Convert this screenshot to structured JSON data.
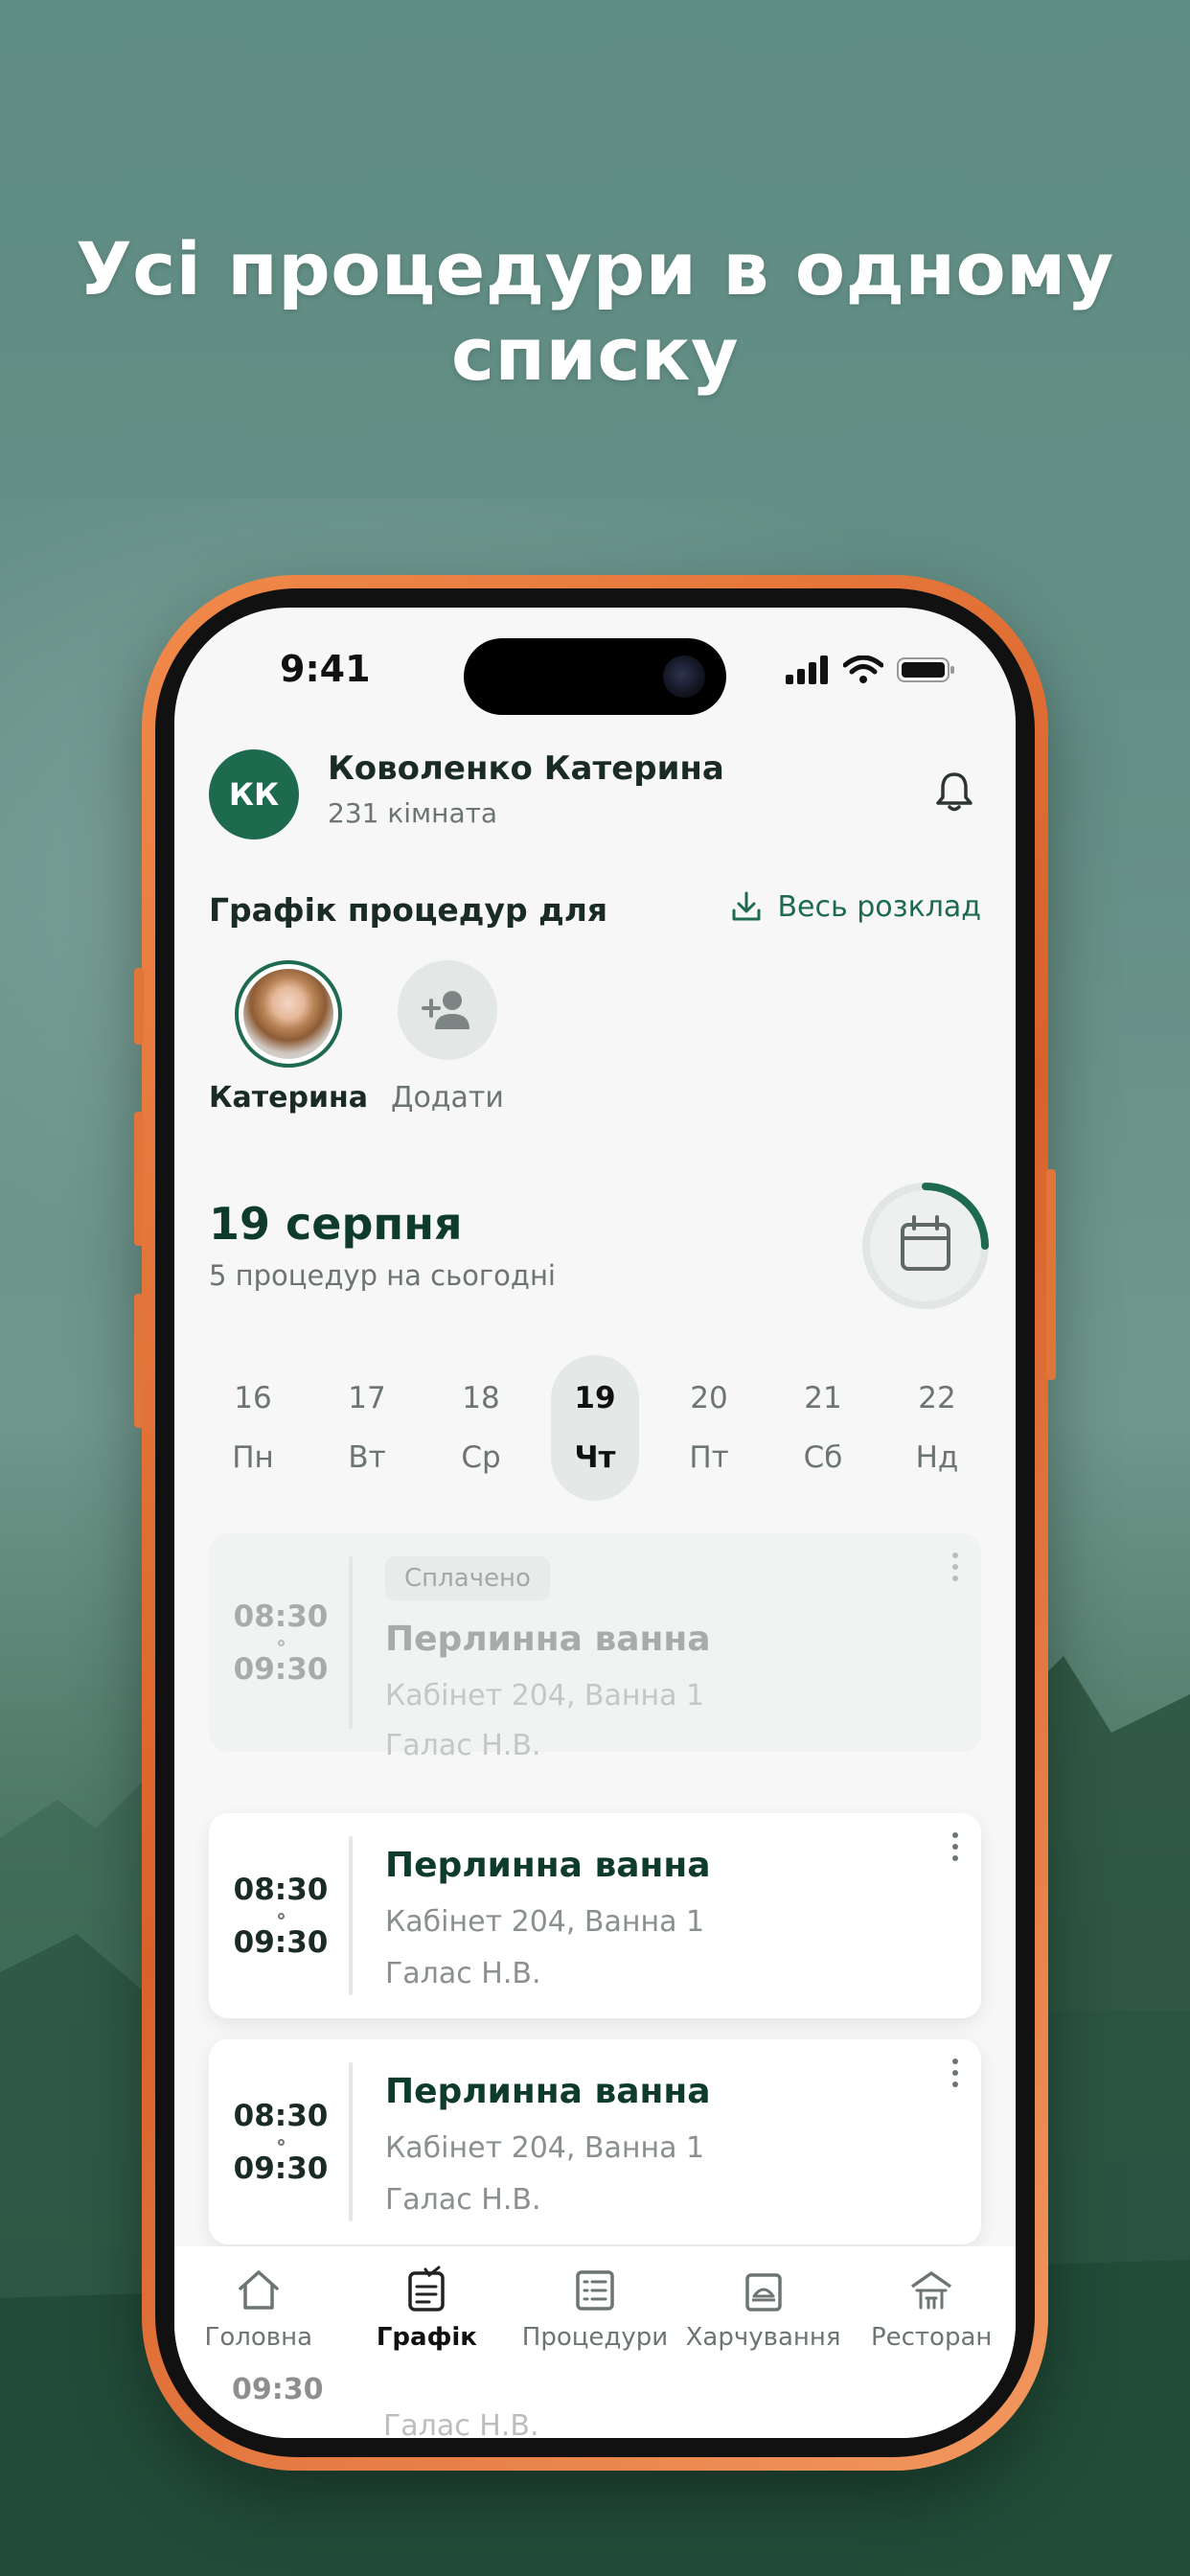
{
  "headline": "Усі процедури в одному списку",
  "status": {
    "time": "9:41"
  },
  "user": {
    "initials": "КК",
    "name": "Коволенко Катерина",
    "room": "231 кімната"
  },
  "schedule": {
    "title": "Графік процедур для",
    "full_schedule_link": "Весь розклад",
    "people": [
      {
        "name": "Катерина",
        "selected": true
      }
    ],
    "add_label": "Додати"
  },
  "date": {
    "title": "19 серпня",
    "subtitle": "5 процедур на сьогодні",
    "progress_fraction": 0.25
  },
  "days": [
    {
      "num": "16",
      "wd": "Пн"
    },
    {
      "num": "17",
      "wd": "Вт"
    },
    {
      "num": "18",
      "wd": "Ср"
    },
    {
      "num": "19",
      "wd": "Чт",
      "active": true
    },
    {
      "num": "20",
      "wd": "Пт"
    },
    {
      "num": "21",
      "wd": "Сб"
    },
    {
      "num": "22",
      "wd": "Нд"
    }
  ],
  "procedures": [
    {
      "badge": "Сплачено",
      "start": "08:30",
      "end": "09:30",
      "title": "Перлинна ванна",
      "room": "Кабінет 204, Ванна 1",
      "doctor": "Галас Н.В."
    },
    {
      "start": "08:30",
      "end": "09:30",
      "title": "Перлинна ванна",
      "room": "Кабінет 204, Ванна 1",
      "doctor": "Галас Н.В."
    },
    {
      "start": "08:30",
      "end": "09:30",
      "title": "Перлинна ванна",
      "room": "Кабінет 204, Ванна 1",
      "doctor": "Галас Н.В."
    }
  ],
  "peek": {
    "time": "09:30",
    "doctor": "Галас Н.В."
  },
  "tabs": [
    {
      "label": "Головна",
      "icon": "home-icon"
    },
    {
      "label": "Графік",
      "icon": "schedule-icon",
      "active": true
    },
    {
      "label": "Процедури",
      "icon": "list-icon"
    },
    {
      "label": "Харчування",
      "icon": "meal-icon"
    },
    {
      "label": "Ресторан",
      "icon": "restaurant-icon"
    }
  ],
  "colors": {
    "accent": "#1e6a4f",
    "phone_frame": "#e8783c",
    "background": "#5f8c83"
  }
}
